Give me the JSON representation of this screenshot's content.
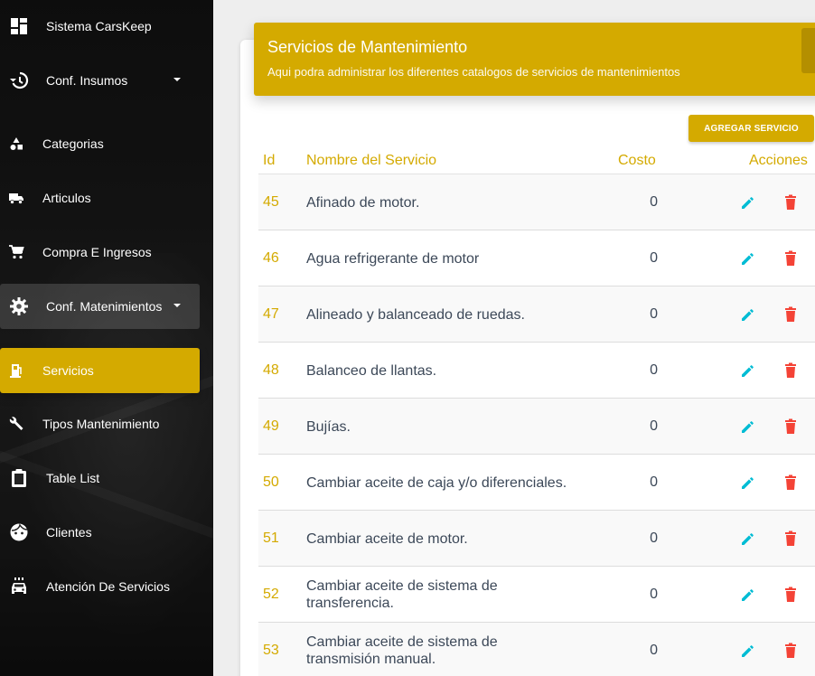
{
  "sidebar": {
    "items": [
      {
        "label": "Sistema CarsKeep",
        "icon": "dashboard-icon"
      },
      {
        "label": "Conf. Insumos",
        "icon": "history-icon"
      },
      {
        "label": "Categorias",
        "icon": "category-icon"
      },
      {
        "label": "Articulos",
        "icon": "truck-icon"
      },
      {
        "label": "Compra E Ingresos",
        "icon": "cart-icon"
      },
      {
        "label": "Conf. Matenimientos",
        "icon": "gear-icon"
      },
      {
        "label": "Servicios",
        "icon": "service-icon"
      },
      {
        "label": "Tipos Mantenimiento",
        "icon": "wrench-icon"
      },
      {
        "label": "Table List",
        "icon": "clipboard-icon"
      },
      {
        "label": "Clientes",
        "icon": "face-icon"
      },
      {
        "label": "Atención De Servicios",
        "icon": "car-icon"
      }
    ]
  },
  "header": {
    "title": "Servicios de Mantenimiento",
    "subtitle": "Aqui podra administrar los diferentes catalogos de servicios de mantenimientos"
  },
  "toolbar": {
    "add_label": "AGREGAR SERVICIO"
  },
  "table": {
    "columns": [
      "Id",
      "Nombre del Servicio",
      "Costo",
      "Acciones"
    ],
    "rows": [
      {
        "id": "45",
        "name": "Afinado de motor.",
        "cost": "0"
      },
      {
        "id": "46",
        "name": "Agua refrigerante de motor",
        "cost": "0"
      },
      {
        "id": "47",
        "name": "Alineado y balanceado de ruedas.",
        "cost": "0"
      },
      {
        "id": "48",
        "name": "Balanceo de llantas.",
        "cost": "0"
      },
      {
        "id": "49",
        "name": "Bujías.",
        "cost": "0"
      },
      {
        "id": "50",
        "name": "Cambiar aceite de caja y/o diferenciales.",
        "cost": "0"
      },
      {
        "id": "51",
        "name": "Cambiar aceite de motor.",
        "cost": "0"
      },
      {
        "id": "52",
        "name": "Cambiar aceite de sistema de transferencia.",
        "cost": "0"
      },
      {
        "id": "53",
        "name": "Cambiar aceite de sistema de transmisión manual.",
        "cost": "0"
      }
    ]
  },
  "colors": {
    "accent": "#d4aa00",
    "edit": "#00bcd4",
    "delete": "#f44336"
  }
}
